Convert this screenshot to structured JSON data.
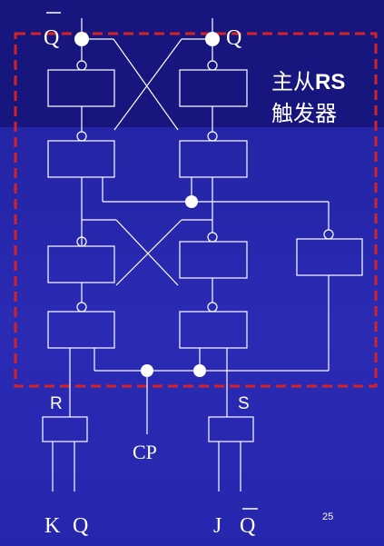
{
  "slide": {
    "page_number": "25",
    "background_color": "#2727aa",
    "line_color": "#ffffff",
    "dash_color": "#d62222"
  },
  "diagram": {
    "title_line1_prefix": "主从",
    "title_line1_bold": "RS",
    "title_line2": "触发器",
    "labels": {
      "qbar_top": "Q",
      "q_top": "Q",
      "r": "R",
      "s": "S",
      "cp": "CP",
      "k": "K",
      "q_bottom": "Q",
      "j": "J",
      "qbar_bottom": "Q"
    }
  }
}
